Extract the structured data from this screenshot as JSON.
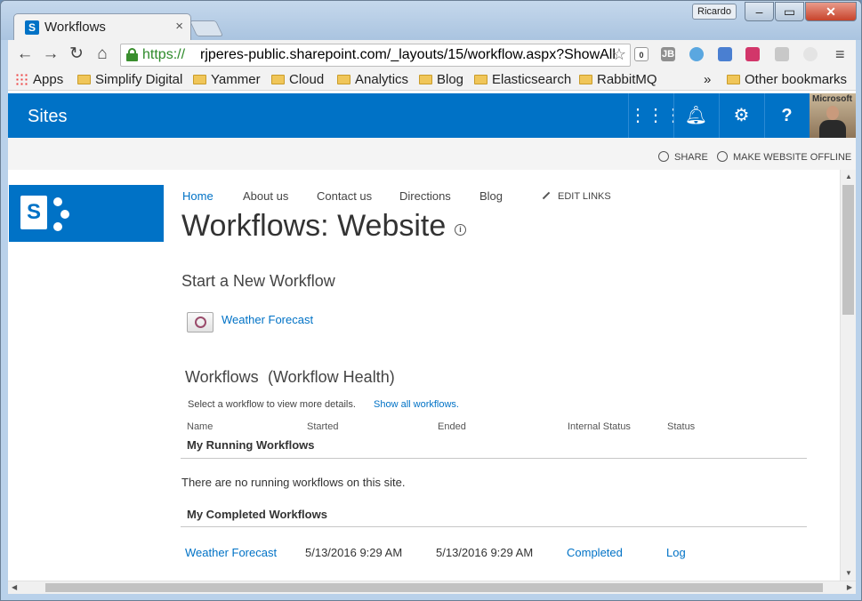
{
  "browser": {
    "tab_title": "Workflows",
    "tab_favicon": "S",
    "user_badge": "Ricardo",
    "url_scheme": "https://",
    "url_rest": "rjperes-public.sharepoint.com/_layouts/15/workflow.aspx?ShowAll",
    "bookmarks": [
      {
        "label": "Apps",
        "icon": "apps-icon"
      },
      {
        "label": "Simplify Digital",
        "icon": "folder-icon"
      },
      {
        "label": "Yammer",
        "icon": "folder-icon"
      },
      {
        "label": "Cloud",
        "icon": "folder-icon"
      },
      {
        "label": "Analytics",
        "icon": "folder-icon"
      },
      {
        "label": "Blog",
        "icon": "folder-icon"
      },
      {
        "label": "Elasticsearch",
        "icon": "folder-icon"
      },
      {
        "label": "RabbitMQ",
        "icon": "folder-icon"
      }
    ],
    "bookmarks_overflow": "»",
    "other_bookmarks": "Other bookmarks",
    "ext_badge": "0",
    "ext_jb": "JB"
  },
  "suite": {
    "title": "Sites",
    "avatar_text": "Microsoft"
  },
  "actions": {
    "share": "SHARE",
    "offline": "MAKE WEBSITE OFFLINE"
  },
  "nav": {
    "items": [
      "Home",
      "About us",
      "Contact us",
      "Directions",
      "Blog"
    ],
    "edit_links": "EDIT LINKS"
  },
  "page": {
    "title": "Workflows: Website",
    "start_heading": "Start a New Workflow",
    "start_item": "Weather Forecast",
    "workflows_heading": "Workflows",
    "health_heading": "(Workflow Health)",
    "hint": "Select a workflow to view more details.",
    "show_all": "Show all workflows.",
    "columns": [
      "Name",
      "Started",
      "Ended",
      "Internal Status",
      "Status"
    ],
    "running_group": "My Running Workflows",
    "no_running": "There are no running workflows on this site.",
    "completed_group": "My Completed Workflows",
    "completed_rows": [
      {
        "name": "Weather Forecast",
        "started": "5/13/2016 9:29 AM",
        "ended": "5/13/2016 9:29 AM",
        "internal_status": "Completed",
        "status": "Log"
      }
    ]
  },
  "colors": {
    "accent": "#0072c6",
    "title_text": "#333333"
  }
}
